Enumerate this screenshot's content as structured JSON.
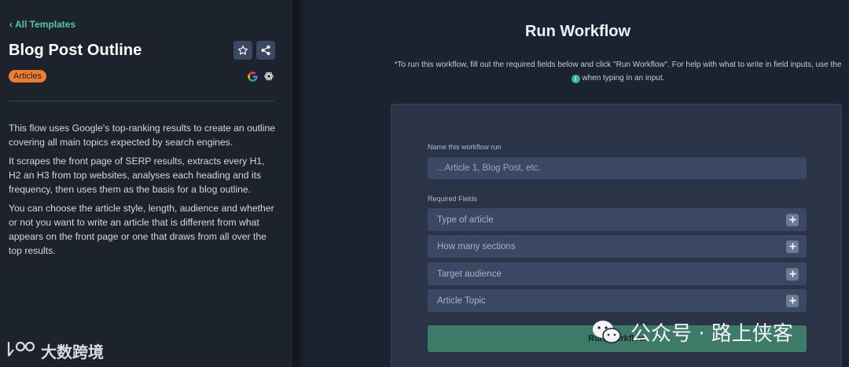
{
  "sidebar": {
    "back_link": "All Templates",
    "title": "Blog Post Outline",
    "tag": "Articles",
    "description": [
      "This flow uses Google's top-ranking results to create an outline covering all main topics expected by search engines.",
      "It scrapes the front page of SERP results, extracts every H1, H2 an H3 from top websites, analyses each heading and its frequency, then uses them as the basis for a blog outline.",
      "You can choose the article style, length, audience and whether or not you want to write an article that is different from what appears on the front page or one that draws from all over the top results."
    ],
    "icons": {
      "star": "star-icon",
      "share": "share-icon",
      "google": "google-icon",
      "openai": "openai-icon"
    }
  },
  "main": {
    "title": "Run Workflow",
    "instructions_before": "*To run this workflow, fill out the required fields below and click \"Run Workflow\". For help with what to write in field inputs, use the",
    "info_glyph": "i",
    "instructions_after": "when typing in an input.",
    "form": {
      "name_label": "Name this workflow run",
      "name_placeholder": "...Article 1, Blog Post, etc.",
      "required_label": "Required Fields",
      "fields": [
        {
          "label": "Type of article"
        },
        {
          "label": "How many sections"
        },
        {
          "label": "Target audience"
        },
        {
          "label": "Article Topic"
        }
      ],
      "run_button": "Run Workflow"
    }
  },
  "watermarks": {
    "left": "大数跨境",
    "right": "公众号 · 路上侠客"
  },
  "colors": {
    "accent_green": "#52c7a1",
    "tag_orange": "#f07d2e",
    "run_button": "#3e7a68"
  }
}
